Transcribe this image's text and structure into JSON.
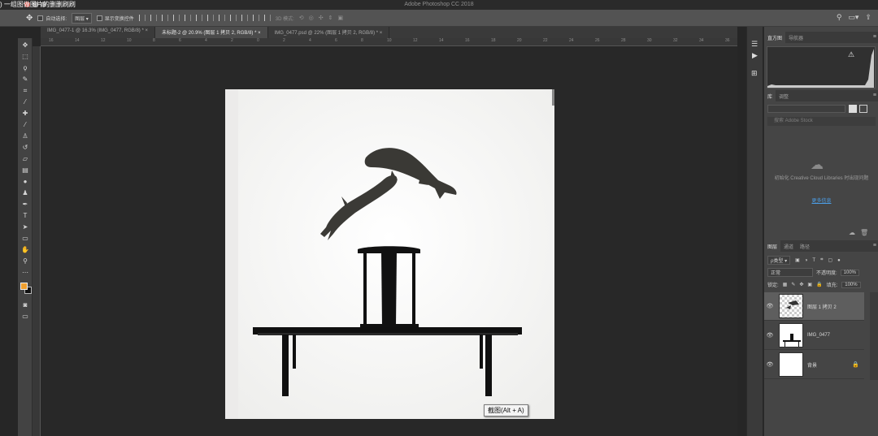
{
  "overlay_caption": ") 一组图做图片的删删刷刷",
  "app": {
    "title": "Adobe Photoshop CC 2018"
  },
  "options_bar": {
    "auto_select_label": "自动选择:",
    "auto_select_value": "图层",
    "transform_controls_label": "显示变换控件",
    "mode_3d_label": "3D 模式:"
  },
  "tabs": [
    {
      "label": "IMG_0477-1 @ 16.3% (IMG_0477, RGB/8) *",
      "active": false
    },
    {
      "label": "未标题-2 @ 20.9% (图层 1 拷贝 2, RGB/8) *",
      "active": true
    },
    {
      "label": "IMG_0477.psd @ 22% (图层 1 拷贝 2, RGB/8) *",
      "active": false
    }
  ],
  "ruler_ticks": [
    "16",
    "14",
    "12",
    "10",
    "8",
    "6",
    "4",
    "2",
    "0",
    "2",
    "4",
    "6",
    "8",
    "10",
    "12",
    "14",
    "16",
    "18",
    "20",
    "22",
    "24",
    "26",
    "28",
    "30",
    "32",
    "34",
    "36"
  ],
  "tooltip": "截图(Alt + A)",
  "panels": {
    "histogram_tabs": [
      "直方图",
      "导航器"
    ],
    "library_tabs": [
      "库",
      "调整"
    ],
    "library_search_placeholder": "搜索 Adobe Stock",
    "cc_message": "初始化 Creative Cloud Libraries 时出现问题",
    "cc_link": "更多信息",
    "layers_tabs": [
      "图层",
      "通道",
      "路径"
    ],
    "kind_filter": "ρ类型",
    "blend_mode": "正常",
    "opacity_label": "不透明度:",
    "opacity_value": "100%",
    "lock_label": "锁定:",
    "fill_label": "填充:",
    "fill_value": "100%",
    "layers": [
      {
        "name": "图层 1 拷贝 2",
        "selected": true
      },
      {
        "name": "IMG_0477",
        "selected": false
      },
      {
        "name": "背景",
        "selected": false
      }
    ]
  },
  "colors": {
    "foreground": "#f0a030",
    "background": "#111111"
  }
}
